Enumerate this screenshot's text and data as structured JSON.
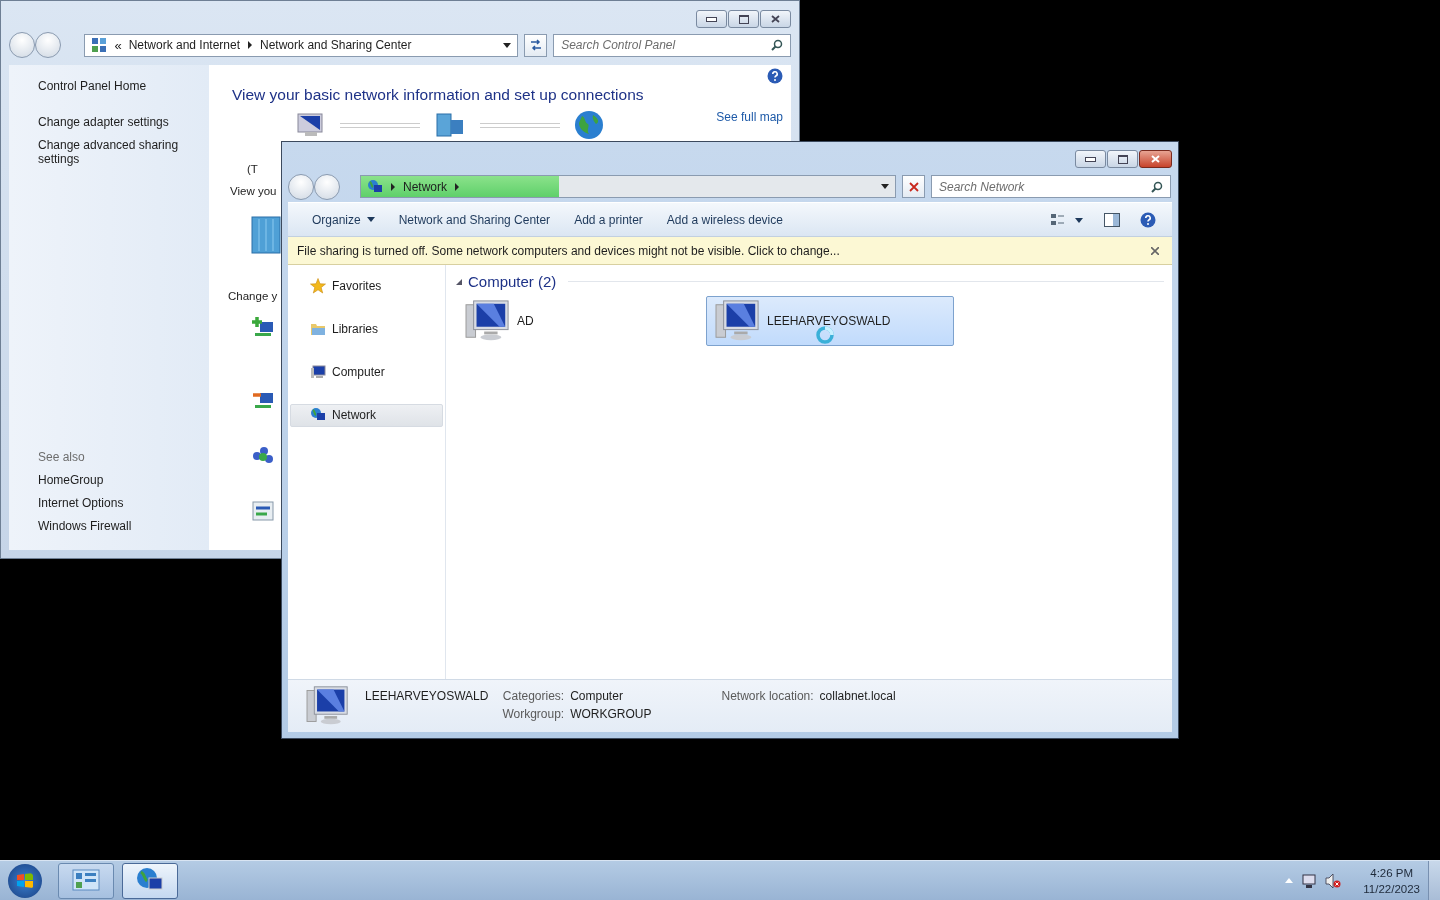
{
  "back_window": {
    "address_bar": {
      "overflow": "«",
      "crumbs": [
        "Network and Internet",
        "Network and Sharing Center"
      ]
    },
    "search": {
      "placeholder": "Search Control Panel"
    },
    "sidebar": {
      "items": [
        "Control Panel Home",
        "Change adapter settings",
        "Change advanced sharing settings"
      ],
      "see_also_heading": "See also",
      "see_also": [
        "HomeGroup",
        "Internet Options",
        "Windows Firewall"
      ]
    },
    "heading": "View your basic network information and set up connections",
    "see_full_map": "See full map",
    "partial_texts": [
      "(T",
      "View you",
      "Change y"
    ]
  },
  "front_window": {
    "address_bar": {
      "crumbs": [
        "Network"
      ],
      "level": 0.37
    },
    "search": {
      "placeholder": "Search Network"
    },
    "toolbar": [
      {
        "label": "Organize",
        "dropdown": true
      },
      {
        "label": "Network and Sharing Center",
        "dropdown": false
      },
      {
        "label": "Add a printer",
        "dropdown": false
      },
      {
        "label": "Add a wireless device",
        "dropdown": false
      }
    ],
    "info_bar": "File sharing is turned off. Some network computers and devices might not be visible. Click to change...",
    "nav_pane": [
      {
        "label": "Favorites",
        "kind": "star",
        "selected": false
      },
      {
        "label": "Libraries",
        "kind": "folder",
        "selected": false
      },
      {
        "label": "Computer",
        "kind": "computer",
        "selected": false
      },
      {
        "label": "Network",
        "kind": "network",
        "selected": true
      }
    ],
    "group": {
      "title": "Computer (2)",
      "expanded": true
    },
    "items": [
      {
        "name": "AD",
        "selected": false
      },
      {
        "name": "LEEHARVEYOSWALD",
        "selected": true
      }
    ],
    "details": {
      "name": "LEEHARVEYOSWALD",
      "fields": [
        {
          "label": "Categories:",
          "value": "Computer"
        },
        {
          "label": "Workgroup:",
          "value": "WORKGROUP"
        },
        {
          "label": "Network location:",
          "value": "collabnet.local"
        }
      ]
    }
  },
  "taskbar": {
    "buttons": [
      {
        "kind": "control-panel",
        "selected": false
      },
      {
        "kind": "network",
        "selected": true
      }
    ],
    "time": "4:26 PM",
    "date": "11/22/2023"
  }
}
